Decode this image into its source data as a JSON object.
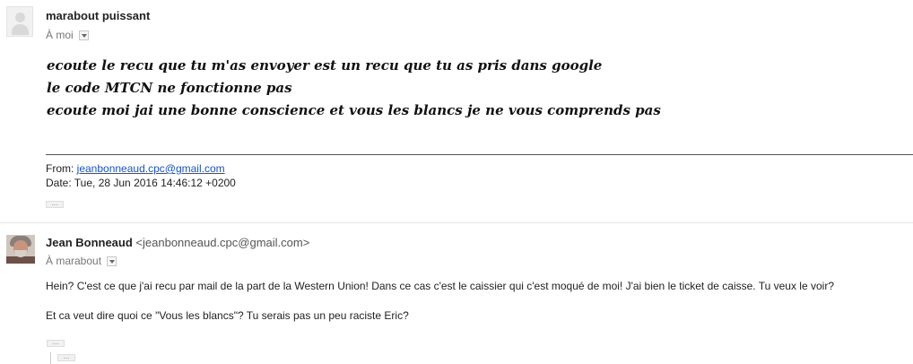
{
  "message1": {
    "sender_name": "marabout puissant",
    "recipient": "À moi",
    "body_lines": [
      "ecoute le recu que tu m'as envoyer est un recu que tu as pris dans google",
      "le code MTCN ne fonctionne pas",
      "ecoute moi jai une bonne conscience et vous les blancs je ne vous comprends pas"
    ],
    "quote_from_label": "From: ",
    "quote_from_email": "jeanbonneaud.cpc@gmail.com",
    "quote_date": "Date: Tue, 28 Jun 2016 14:46:12 +0200",
    "show_trimmed": "..."
  },
  "message2": {
    "sender_name": "Jean Bonneaud",
    "sender_email": "<jeanbonneaud.cpc@gmail.com>",
    "recipient": "À marabout",
    "paragraph1": "Hein? C'est ce que j'ai recu par mail de la part de la Western Union! Dans ce cas c'est le caissier qui c'est moqué de moi! J'ai bien le ticket de caisse. Tu veux le voir?",
    "paragraph2": "Et ca veut dire quoi ce \"Vous les blancs\"? Tu serais pas un peu raciste Eric?",
    "show_trimmed": "...",
    "show_trimmed_2": "..."
  }
}
